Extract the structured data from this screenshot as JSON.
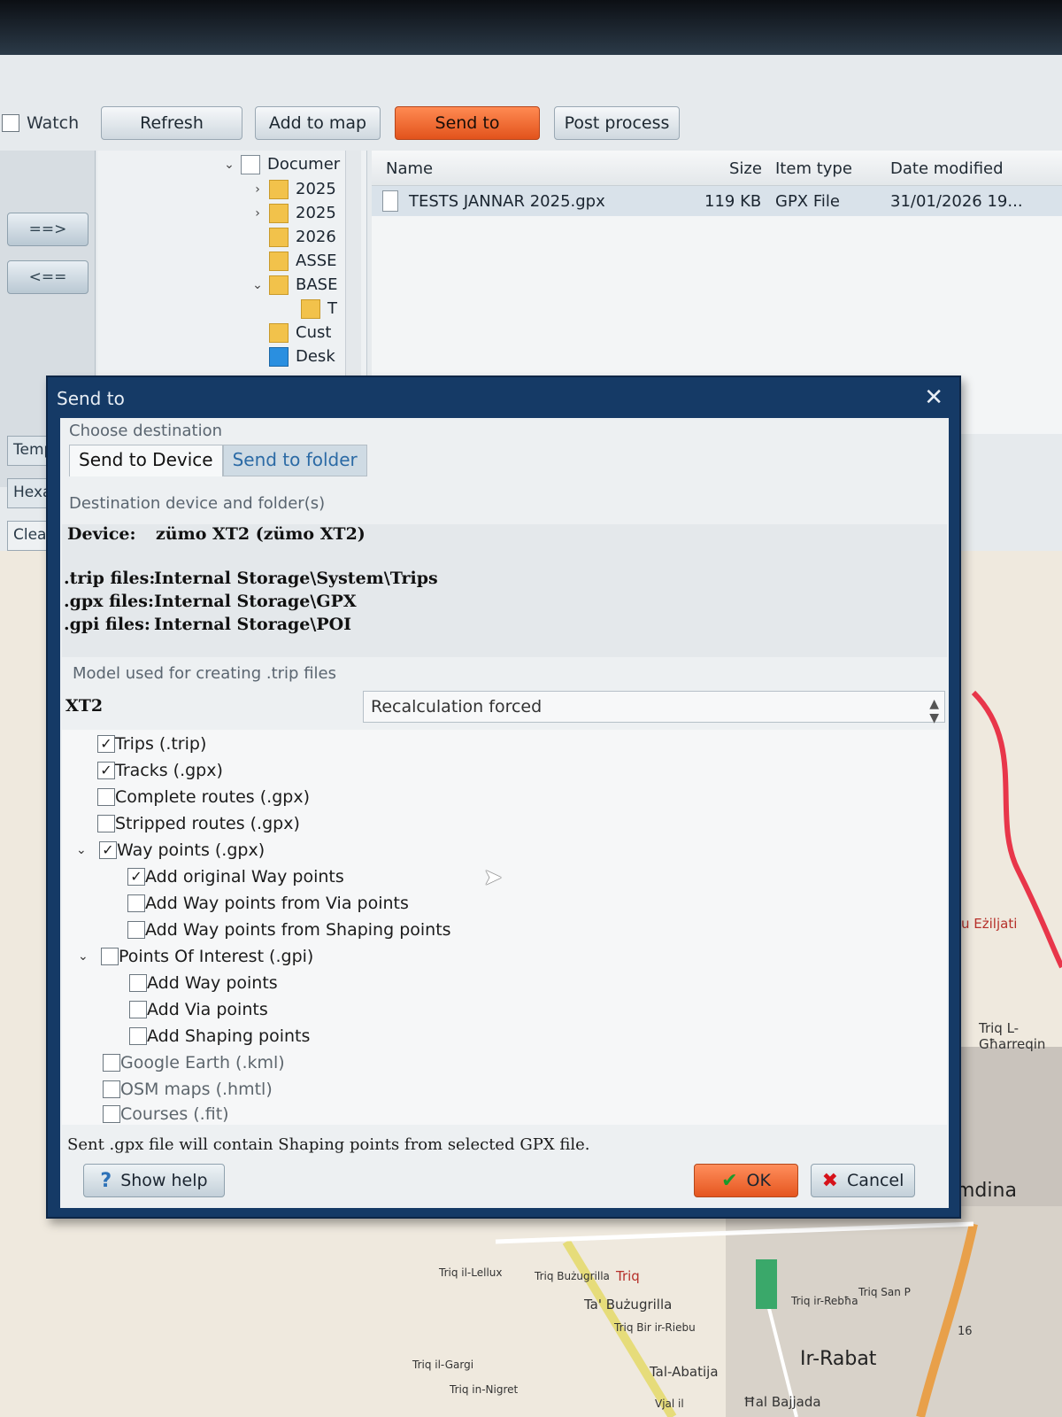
{
  "toolbar": {
    "watch_label": "Watch",
    "refresh_label": "Refresh",
    "add_to_map_label": "Add to map",
    "send_to_label": "Send to",
    "post_process_label": "Post process"
  },
  "left_buttons": {
    "forward": "==>",
    "back": "<=="
  },
  "side_tabs": [
    "Temp",
    "Hexa",
    "Clea"
  ],
  "tree": {
    "items": [
      {
        "label": "Documer",
        "icon": "document-icon",
        "expanded": true
      },
      {
        "label": "2025",
        "icon": "folder-icon"
      },
      {
        "label": "2025",
        "icon": "folder-icon"
      },
      {
        "label": "2026",
        "icon": "folder-icon"
      },
      {
        "label": "ASSE",
        "icon": "folder-icon"
      },
      {
        "label": "BASE",
        "icon": "folder-icon",
        "expanded": true
      },
      {
        "label": "T",
        "icon": "folder-icon"
      },
      {
        "label": "Cust",
        "icon": "folder-icon"
      },
      {
        "label": "Desk",
        "icon": "desktop-folder-icon"
      }
    ]
  },
  "file_list": {
    "columns": [
      "Name",
      "Size",
      "Item type",
      "Date modified"
    ],
    "rows": [
      {
        "name": "TESTS JANNAR 2025.gpx",
        "size": "119 KB",
        "type": "GPX File",
        "date": "31/01/2026 19..."
      }
    ]
  },
  "dialog": {
    "title": "Send to",
    "choose_destination": "Choose destination",
    "tab_device": "Send to Device",
    "tab_folder": "Send to folder",
    "dest_group": "Destination device and folder(s)",
    "device_key": "Device:",
    "device_val": "zümo XT2 (zümo XT2)",
    "trip_key": ".trip files:",
    "trip_val": "Internal Storage\\System\\Trips",
    "gpx_key": ".gpx files:",
    "gpx_val": "Internal Storage\\GPX",
    "gpi_key": ".gpi files:",
    "gpi_val": "Internal Storage\\POI",
    "model_group": "Model used for creating .trip files",
    "model_value": "XT2",
    "recalc_value": "Recalculation forced",
    "options": [
      {
        "label": "Trips (.trip)",
        "checked": true
      },
      {
        "label": "Tracks (.gpx)",
        "checked": true
      },
      {
        "label": "Complete routes (.gpx)",
        "checked": false
      },
      {
        "label": "Stripped routes (.gpx)",
        "checked": false
      },
      {
        "label": "Way points (.gpx)",
        "checked": true
      },
      {
        "label": "Add original Way points",
        "checked": true
      },
      {
        "label": "Add Way points from Via points",
        "checked": false
      },
      {
        "label": "Add Way points from Shaping points",
        "checked": false
      },
      {
        "label": "Points Of Interest (.gpi)",
        "checked": false
      },
      {
        "label": "Add Way points",
        "checked": false
      },
      {
        "label": "Add Via points",
        "checked": false
      },
      {
        "label": "Add Shaping points",
        "checked": false
      },
      {
        "label": "Google Earth (.kml)",
        "checked": false
      },
      {
        "label": "OSM maps (.hmtl)",
        "checked": false
      },
      {
        "label": "Courses (.fit)",
        "checked": false
      }
    ],
    "status_text": "Sent .gpx file will contain Shaping points from selected GPX file.",
    "help_label": "Show help",
    "ok_label": "OK",
    "cancel_label": "Cancel"
  },
  "map_labels": [
    "u Eżiljati",
    "Triq L-Għarreqin",
    "mdina",
    "Ta' Bużugrilla",
    "Triq Bużugrilla",
    "Triq Bir ir-Riebu",
    "Triq ir-Rebħa",
    "Triq San P",
    "Ir-Rabat",
    "Tal-Abatija",
    "Ħal Bajjada",
    "Triq il-Gargi",
    "Triq il-Lellux",
    "Triq in-Nigret",
    "16",
    "Triq",
    "Vjal il"
  ],
  "colors": {
    "send_to_accent": "#e85c22",
    "dialog_frame": "#153a66",
    "route_red": "#e8364a"
  }
}
